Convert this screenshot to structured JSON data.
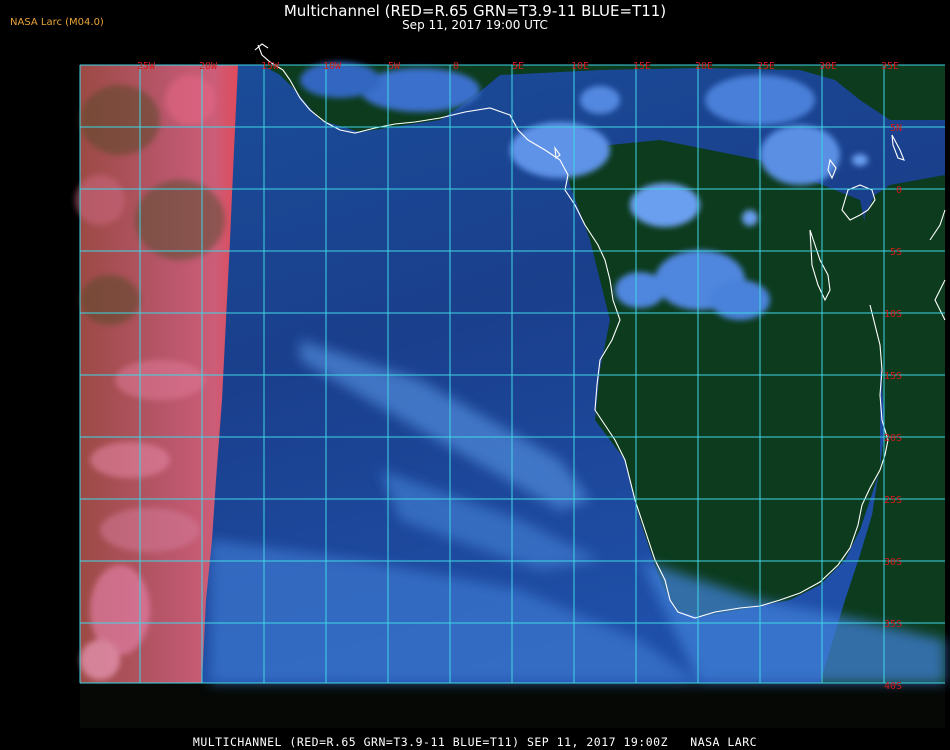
{
  "header": {
    "title": "Multichannel (RED=R.65 GRN=T3.9-11 BLUE=T11)",
    "subtitle": "Sep 11, 2017 19:00 UTC",
    "credit": "NASA Larc (M04.0)"
  },
  "footer": {
    "text": "MULTICHANNEL (RED=R.65 GRN=T3.9-11 BLUE=T11) SEP 11, 2017 19:00Z   NASA LARC"
  },
  "map": {
    "lon_labels": [
      "25W",
      "20W",
      "15W",
      "10W",
      "5W",
      "0",
      "5E",
      "10E",
      "15E",
      "20E",
      "25E",
      "30E",
      "35E"
    ],
    "lat_labels": [
      "5N",
      "0",
      "5S",
      "10S",
      "15S",
      "20S",
      "25S",
      "30S",
      "35S",
      "40S"
    ],
    "colors": {
      "grid": "#3fd6e6",
      "labels": "#d21a1a",
      "coast": "#ffffff",
      "ocean": "#1a3d8a",
      "land": "#0b3a1c",
      "sunlit_edge": "#c85a6a"
    }
  }
}
